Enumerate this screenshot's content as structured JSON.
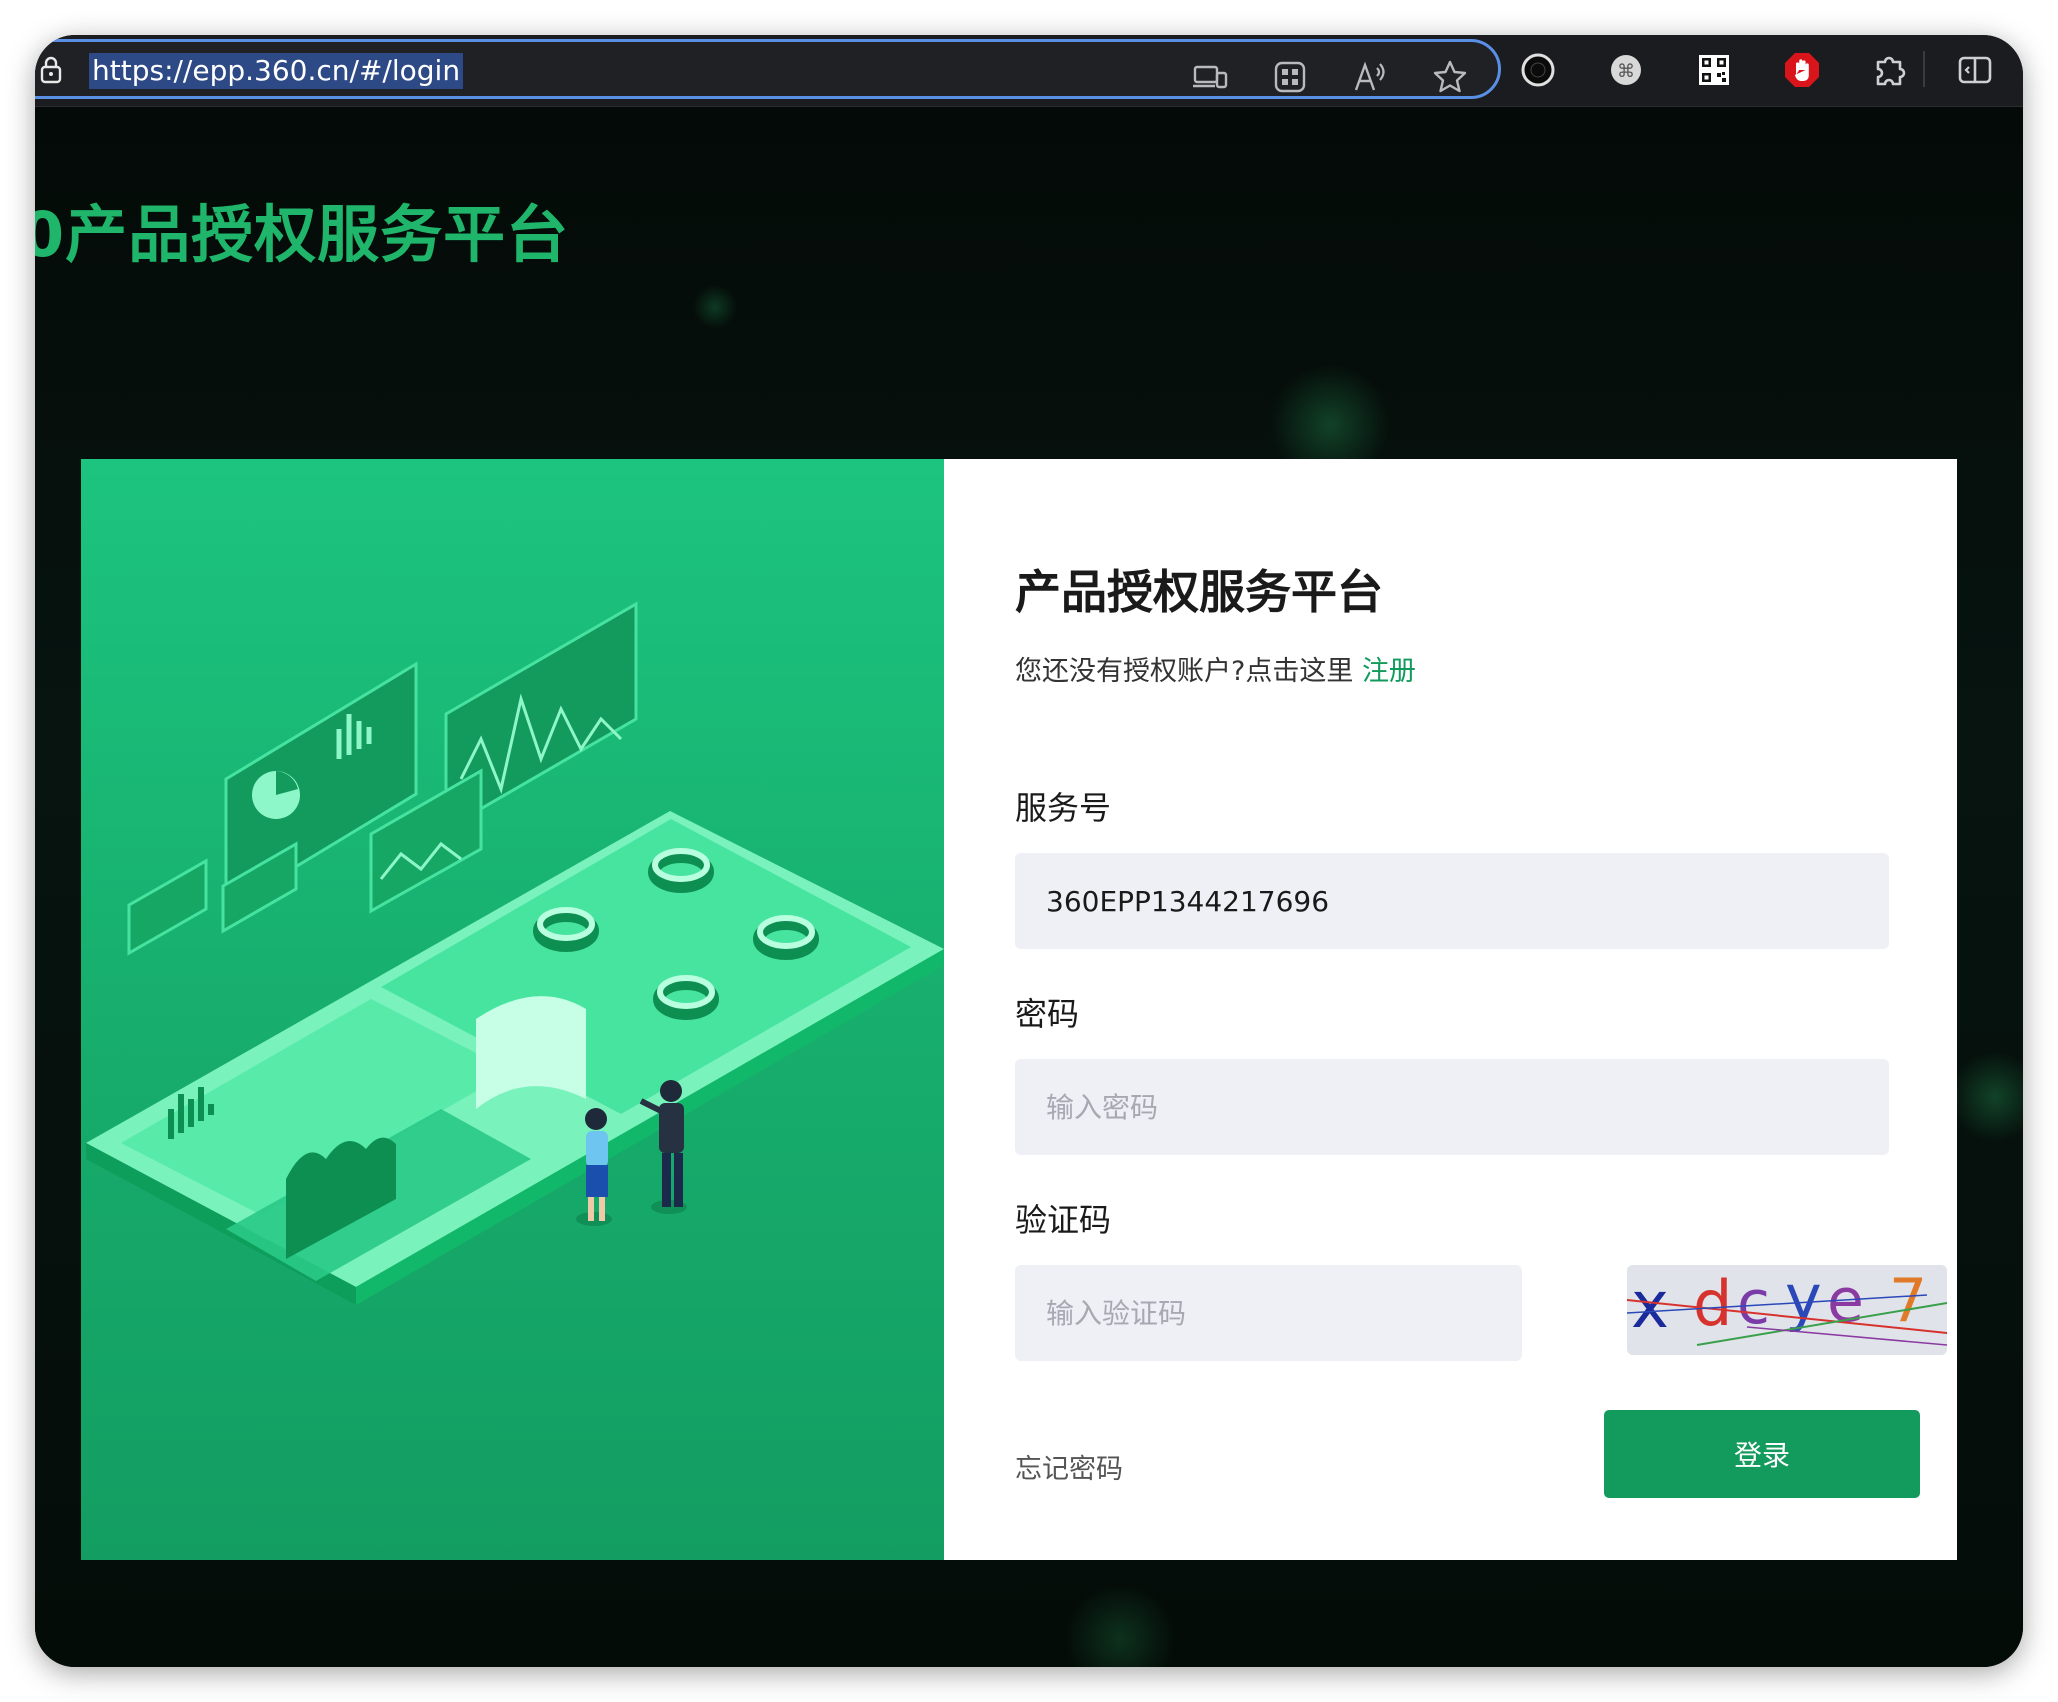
{
  "browser": {
    "url": "https://epp.360.cn/#/login",
    "icons": [
      "lock-icon",
      "devices-icon",
      "apps-icon",
      "read-aloud-icon",
      "favorite-star-icon"
    ],
    "extensions": [
      "record-ext-icon",
      "command-ext-icon",
      "qr-code-ext-icon",
      "adblock-hand-icon",
      "extensions-puzzle-icon",
      "split-screen-icon"
    ]
  },
  "page": {
    "brand_title": "0产品授权服务平台"
  },
  "login_form": {
    "title": "产品授权服务平台",
    "register_prompt": "您还没有授权账户?点击这里",
    "register_link": "注册",
    "service_label": "服务号",
    "service_value": "360EPP1344217696",
    "password_label": "密码",
    "password_placeholder": "输入密码",
    "captcha_label": "验证码",
    "captcha_placeholder": "输入验证码",
    "captcha_text": "xdcye7",
    "forgot_password": "忘记密码",
    "login_button": "登录"
  },
  "colors": {
    "accent": "#139a5d",
    "brand_green": "#1fb56a",
    "url_focus": "#5a8fe6"
  }
}
